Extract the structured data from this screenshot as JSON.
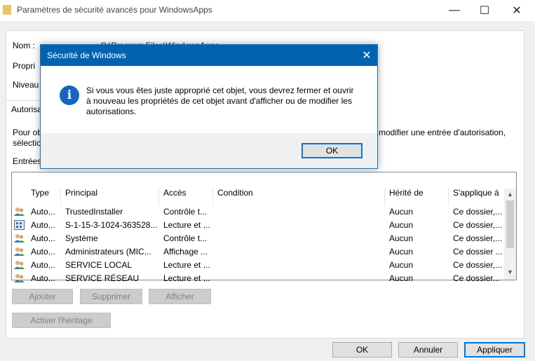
{
  "window": {
    "title": "Paramètres de sécurité avancés pour WindowsApps",
    "minimize": "—",
    "maximize": "☐",
    "close": "✕"
  },
  "main": {
    "name_label": "Nom :",
    "name_value": "C:\\Program Files\\WindowsApps",
    "owner_label": "Propri",
    "level_label": "Niveau",
    "tab_label": "Autorisations",
    "desc_left_1": "Pour ob",
    "desc_left_2": "sélectio",
    "desc_right": "modifier une entrée d'autorisation,",
    "entries_label": "Entrées"
  },
  "table": {
    "columns": [
      "Type",
      "Principal",
      "Accès",
      "Condition",
      "Hérité de",
      "S'applique à"
    ],
    "rows": [
      {
        "icon": "user-group-icon",
        "type": "Auto...",
        "principal": "TrustedInstaller",
        "access": "Contrôle t...",
        "condition": "",
        "inherited": "Aucun",
        "applies": "Ce dossier,..."
      },
      {
        "icon": "package-icon",
        "type": "Auto...",
        "principal": "S-1-15-3-1024-363528...",
        "access": "Lecture et ...",
        "condition": "",
        "inherited": "Aucun",
        "applies": "Ce dossier,..."
      },
      {
        "icon": "user-group-icon",
        "type": "Auto...",
        "principal": "Système",
        "access": "Contrôle t...",
        "condition": "",
        "inherited": "Aucun",
        "applies": "Ce dossier,..."
      },
      {
        "icon": "user-group-icon",
        "type": "Auto...",
        "principal": "Administrateurs (MIC...",
        "access": "Affichage ...",
        "condition": "",
        "inherited": "Aucun",
        "applies": "Ce dossier ..."
      },
      {
        "icon": "user-group-icon",
        "type": "Auto...",
        "principal": "SERVICE LOCAL",
        "access": "Lecture et ...",
        "condition": "",
        "inherited": "Aucun",
        "applies": "Ce dossier,..."
      },
      {
        "icon": "user-group-icon",
        "type": "Auto...",
        "principal": "SERVICE RÉSEAU",
        "access": "Lecture et ...",
        "condition": "",
        "inherited": "Aucun",
        "applies": "Ce dossier..."
      }
    ]
  },
  "buttons": {
    "add": "Ajouter",
    "remove": "Supprimer",
    "view": "Afficher",
    "enable_inheritance": "Activer l'héritage",
    "ok": "OK",
    "cancel": "Annuler",
    "apply": "Appliquer"
  },
  "dialog": {
    "title": "Sécurité de Windows",
    "close": "✕",
    "icon_glyph": "i",
    "message_line1": "Si vous vous êtes juste approprié cet objet, vous devrez fermer et ouvrir",
    "message_line2": "à nouveau les propriétés de cet objet avant d'afficher ou de modifier les",
    "message_line3": "autorisations.",
    "ok": "OK"
  },
  "colors": {
    "dialog_title_bg": "#0063b1",
    "info_icon": "#1565c0",
    "default_button_border": "#0078d7"
  }
}
